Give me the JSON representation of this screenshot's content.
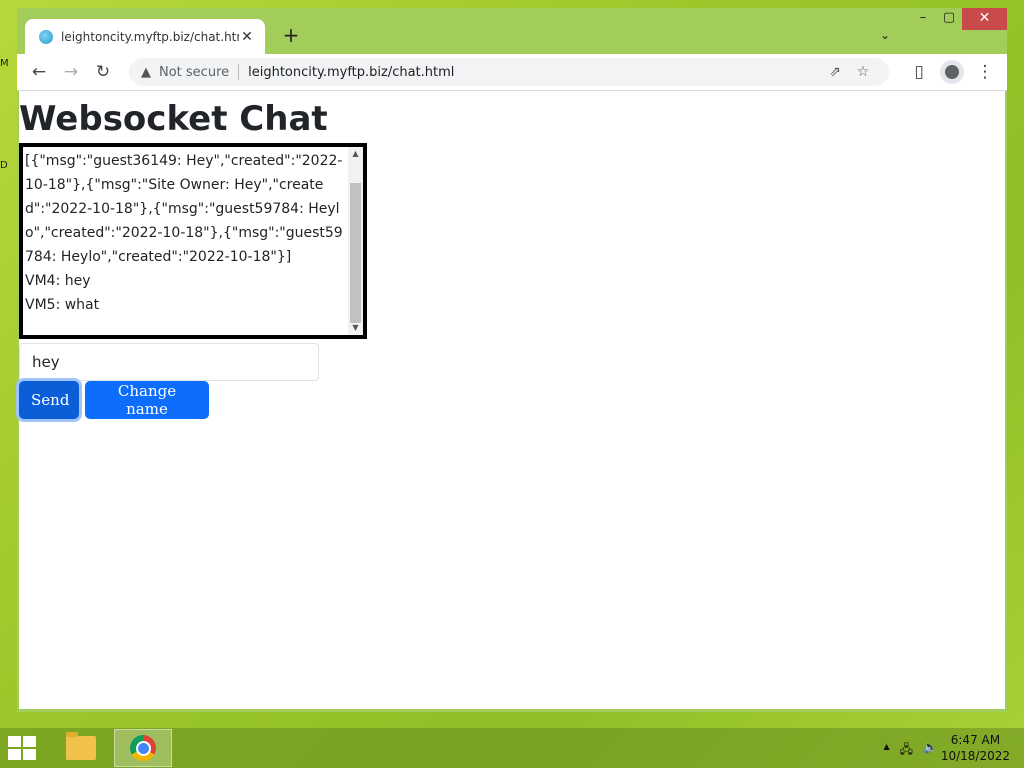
{
  "desktop": {
    "edge_label_1": "M",
    "edge_label_2": "D"
  },
  "browser": {
    "tab": {
      "title": "leightoncity.myftp.biz/chat.html",
      "close": "✕"
    },
    "new_tab": "+",
    "tab_search": "⌄",
    "window_controls": {
      "minimize": "–",
      "maximize": "▢",
      "close": "✕"
    },
    "nav": {
      "back": "←",
      "forward": "→",
      "reload": "↻"
    },
    "omnibox": {
      "warning_icon": "▲",
      "security_label": "Not secure",
      "url": "leightoncity.myftp.biz/chat.html",
      "share_icon": "⇗",
      "star_icon": "☆"
    },
    "side_panel_icon": "▯",
    "menu_icon": "⋮"
  },
  "page": {
    "title": "Websocket Chat",
    "chat_log": "[{\"msg\":\"guest36149: Hey\",\"created\":\"2022-10-18\"},{\"msg\":\"Site Owner: Hey\",\"created\":\"2022-10-18\"},{\"msg\":\"guest59784: Heylo\",\"created\":\"2022-10-18\"},{\"msg\":\"guest59784: Heylo\",\"created\":\"2022-10-18\"}]\nVM4: hey\nVM5: what",
    "message_input": {
      "value": "hey"
    },
    "buttons": {
      "send": "Send",
      "change_name": "Change name"
    }
  },
  "taskbar": {
    "tray_arrow": "▲",
    "network_icon": "🖧",
    "volume_icon": "🔈",
    "time": "6:47 AM",
    "date": "10/18/2022"
  }
}
